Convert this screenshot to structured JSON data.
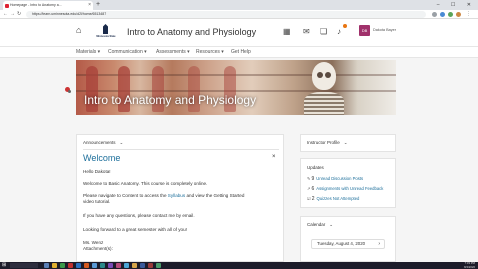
{
  "browser": {
    "tab_title": "Homepage - Intro to Anatomy a...",
    "tab_close": "×",
    "new_tab": "+",
    "window_controls": "– ☐ ✕",
    "url": "https://learn.uminnesota.edu/d2l/home/6513487"
  },
  "header": {
    "home_icon": "⌂",
    "logo_text": "Minnesota State",
    "course_title": "Intro to Anatomy and Physiology",
    "avatar_initials": "DB",
    "user_name": "Dakota Bayer"
  },
  "nav": {
    "items": [
      {
        "label": "Materials ▾"
      },
      {
        "label": "Communication ▾"
      },
      {
        "label": "Assessments ▾"
      },
      {
        "label": "Resources ▾"
      },
      {
        "label": "Get Help"
      }
    ]
  },
  "banner": {
    "title": "Intro to Anatomy and Physiology"
  },
  "announcements": {
    "heading": "Announcements",
    "chevron": "⌄",
    "title": "Welcome",
    "close": "×",
    "lines": [
      "Hello Dakota!",
      "Welcome to Basic Anatomy.  This course is completely online.",
      "Please navigate to Content to access the",
      "Syllabus",
      "and view the Getting Started",
      "video tutorial.",
      "If you have any questions, please contact me by email.",
      "Looking forward to a great semester with all of you!",
      "Ms. Wenz",
      "Attachment(s):"
    ]
  },
  "instructor": {
    "heading": "Instructor Profile",
    "chevron": "⌄"
  },
  "updates": {
    "heading": "Updates",
    "items": [
      {
        "count": "9",
        "label": "Unread Discussion Posts"
      },
      {
        "count": "6",
        "label": "Assignments with Unread Feedback"
      },
      {
        "count": "2",
        "label": "Quizzes Not Attempted"
      }
    ]
  },
  "calendar": {
    "heading": "Calendar",
    "chevron": "⌄",
    "date": "Tuesday, August 4, 2020",
    "next": "›"
  },
  "taskbar": {
    "time": "7:33 PM",
    "date": "8/4/2020"
  },
  "colors": {
    "accent_link": "#1d6f9b",
    "avatar_bg": "#a0316b",
    "notification_dot": "#e87511"
  }
}
